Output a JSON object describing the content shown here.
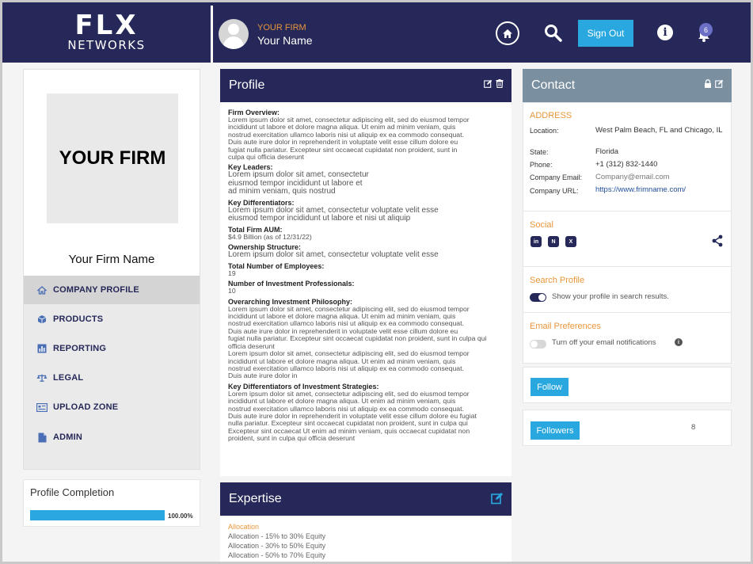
{
  "header": {
    "logo_main": "FLX",
    "logo_sub": "NETWORKS",
    "user_firm": "YOUR FIRM",
    "user_name": "Your Name",
    "signout_label": "Sign Out",
    "notification_count": "6"
  },
  "sidebar": {
    "firm_logo_text": "YOUR FIRM",
    "firm_name": "Your Firm Name",
    "items": [
      {
        "label": "COMPANY PROFILE",
        "icon": "home-icon",
        "active": true
      },
      {
        "label": "PRODUCTS",
        "icon": "box-icon",
        "active": false
      },
      {
        "label": "REPORTING",
        "icon": "bar-chart-icon",
        "active": false
      },
      {
        "label": "LEGAL",
        "icon": "scale-icon",
        "active": false
      },
      {
        "label": "UPLOAD ZONE",
        "icon": "upload-card-icon",
        "active": false
      },
      {
        "label": "ADMIN",
        "icon": "file-icon",
        "active": false
      }
    ],
    "progress_title": "Profile Completion",
    "progress_pct": "100.00%",
    "progress_value": 100
  },
  "profile": {
    "title": "Profile",
    "sections": [
      {
        "title": "Firm Overview:",
        "lines": [
          "Lorem ipsum dolor sit amet, consectetur adipiscing elit, sed do eiusmod tempor",
          "incididunt ut labore et dolore magna aliqua. Ut enim ad minim veniam, quis",
          "nostrud exercitation ullamco laboris nisi ut aliquip ex ea commodo consequat.",
          "Duis aute irure dolor in reprehenderit in voluptate velit esse cillum dolore eu",
          "fugiat nulla pariatur. Excepteur sint occaecat cupidatat non proident, sunt in",
          "culpa qui officia deserunt"
        ],
        "big": false
      },
      {
        "title": "Key Leaders:",
        "lines": [
          "Lorem ipsum dolor sit amet, consectetur",
          "eiusmod tempor incididunt ut labore et",
          "ad minim veniam, quis nostrud"
        ],
        "big": true
      },
      {
        "title": "Key Differentiators:",
        "lines": [
          "Lorem ipsum dolor sit amet, consectetur voluptate velit esse",
          "eiusmod tempor incididunt ut labore et nisi ut aliquip"
        ],
        "big": true
      },
      {
        "title": "Total Firm AUM:",
        "lines": [
          "$4.9 Billion (as of 12/31/22)"
        ],
        "big": false
      },
      {
        "title": "Ownership Structure:",
        "lines": [
          "Lorem ipsum dolor sit amet, consectetur voluptate velit esse"
        ],
        "big": true
      },
      {
        "title": "Total Number of Employees:",
        "lines": [
          "19"
        ],
        "big": false
      },
      {
        "title": "Number of Investment Professionals:",
        "lines": [
          "10"
        ],
        "big": false
      },
      {
        "title": "Overarching Investment Philosophy:",
        "lines": [
          "Lorem ipsum dolor sit amet, consectetur adipiscing elit, sed do eiusmod tempor",
          "incididunt ut labore et dolore magna aliqua. Ut enim ad minim veniam, quis",
          "nostrud exercitation ullamco laboris nisi ut aliquip ex ea commodo consequat.",
          "Duis aute irure dolor in reprehenderit in voluptate velit esse cillum dolore eu",
          "fugiat nulla pariatur. Excepteur sint occaecat cupidatat non proident, sunt in culpa qui",
          "officia deserunt",
          "Lorem ipsum dolor sit amet, consectetur adipiscing elit, sed do eiusmod tempor",
          "incididunt ut labore et dolore magna aliqua. Ut enim ad minim veniam, quis",
          "nostrud exercitation ullamco laboris nisi ut aliquip ex ea commodo consequat.",
          "Duis aute irure dolor in"
        ],
        "big": false
      },
      {
        "title": "Key Differentiators of Investment Strategies:",
        "lines": [
          "Lorem ipsum dolor sit amet, consectetur adipiscing elit, sed do eiusmod tempor",
          "incididunt ut labore et dolore magna aliqua. Ut enim ad minim veniam, quis",
          "nostrud exercitation ullamco laboris nisi ut aliquip ex ea commodo consequat.",
          "Duis aute irure dolor in reprehenderit in voluptate velit esse cillum dolore eu fugiat",
          "nulla pariatur. Excepteur sint occaecat cupidatat non proident, sunt in culpa qui",
          "Excepteur sint occaecat Ut enim ad minim veniam, quis occaecat cupidatat non",
          "proident, sunt in culpa qui officia deserunt"
        ],
        "big": false
      }
    ]
  },
  "expertise": {
    "title": "Expertise",
    "category": "Allocation",
    "items": [
      "Allocation - 15% to 30% Equity",
      "Allocation - 30% to 50% Equity",
      "Allocation - 50% to 70% Equity"
    ]
  },
  "contact": {
    "title": "Contact",
    "address_heading": "ADDRESS",
    "location_label": "Location:",
    "location_value": "West Palm Beach, FL and Chicago, IL",
    "state_label": "State:",
    "state_value": "Florida",
    "phone_label": "Phone:",
    "phone_value": "+1 (312) 832-1440",
    "email_label": "Company Email:",
    "email_value": "Company@email.com",
    "url_label": "Company URL:",
    "url_value": "https://www.frimname.com/",
    "social_heading": "Social",
    "social_icons": [
      "in",
      "N",
      "X"
    ],
    "search_heading": "Search Profile",
    "search_text": "Show your profile in search results.",
    "email_pref_heading": "Email Preferences",
    "email_pref_text": "Turn off your email notifications",
    "follow_label": "Follow",
    "followers_label": "Followers",
    "followers_count": "8"
  },
  "colors": {
    "navy": "#252858",
    "accent_blue": "#29a8e0",
    "orange": "#e8963a",
    "contact_header": "#7a8fa0"
  }
}
